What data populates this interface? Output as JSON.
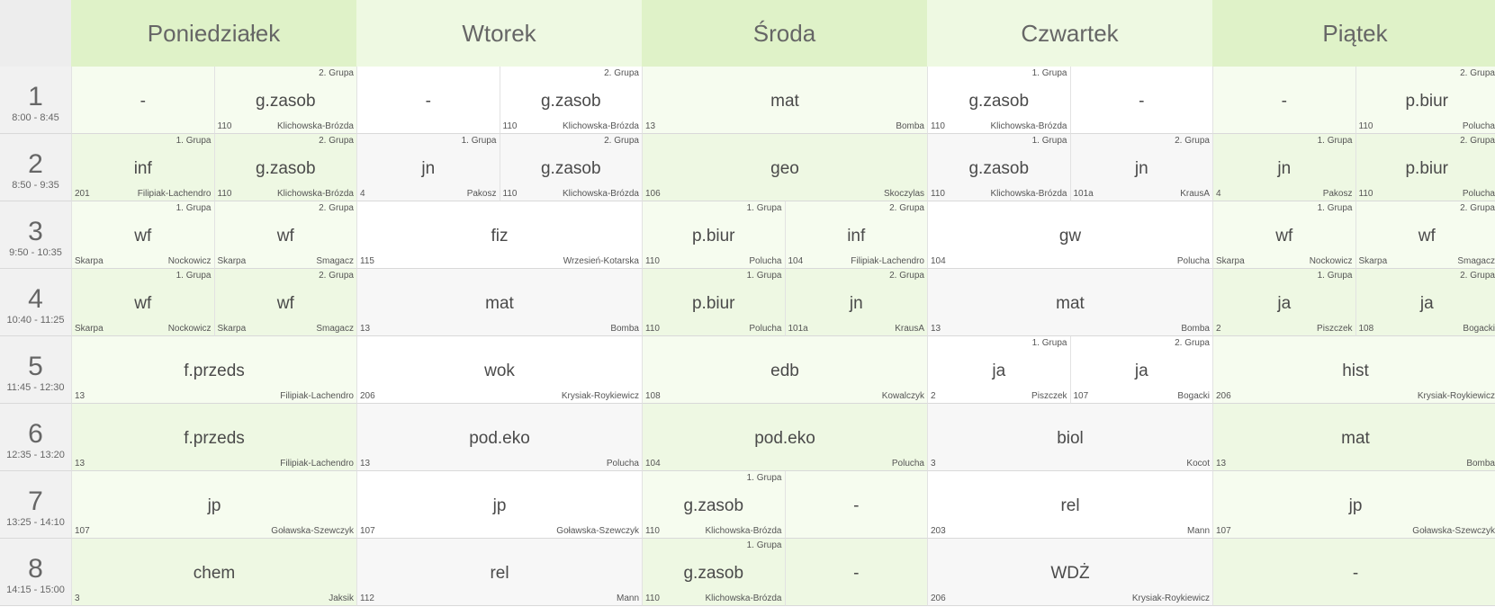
{
  "days": [
    "Poniedziałek",
    "Wtorek",
    "Środa",
    "Czwartek",
    "Piątek"
  ],
  "periods": [
    {
      "num": "1",
      "time": "8:00 - 8:45"
    },
    {
      "num": "2",
      "time": "8:50 - 9:35"
    },
    {
      "num": "3",
      "time": "9:50 - 10:35"
    },
    {
      "num": "4",
      "time": "10:40 - 11:25"
    },
    {
      "num": "5",
      "time": "11:45 - 12:30"
    },
    {
      "num": "6",
      "time": "12:35 - 13:20"
    },
    {
      "num": "7",
      "time": "13:25 - 14:10"
    },
    {
      "num": "8",
      "time": "14:15 - 15:00"
    }
  ],
  "grid": [
    [
      [
        {
          "subj": "-"
        },
        {
          "subj": "g.zasob",
          "grp": "2. Grupa",
          "room": "110",
          "teacher": "Klichowska-Brózda"
        }
      ],
      [
        {
          "subj": "-"
        },
        {
          "subj": "g.zasob",
          "grp": "2. Grupa",
          "room": "110",
          "teacher": "Klichowska-Brózda"
        }
      ],
      [
        {
          "subj": "mat",
          "room": "13",
          "teacher": "Bomba"
        }
      ],
      [
        {
          "subj": "g.zasob",
          "grp": "1. Grupa",
          "room": "110",
          "teacher": "Klichowska-Brózda"
        },
        {
          "subj": "-"
        }
      ],
      [
        {
          "subj": "-"
        },
        {
          "subj": "p.biur",
          "grp": "2. Grupa",
          "room": "110",
          "teacher": "Polucha"
        }
      ]
    ],
    [
      [
        {
          "subj": "inf",
          "grp": "1. Grupa",
          "room": "201",
          "teacher": "Filipiak-Lachendro"
        },
        {
          "subj": "g.zasob",
          "grp": "2. Grupa",
          "room": "110",
          "teacher": "Klichowska-Brózda"
        }
      ],
      [
        {
          "subj": "jn",
          "grp": "1. Grupa",
          "room": "4",
          "teacher": "Pakosz"
        },
        {
          "subj": "g.zasob",
          "grp": "2. Grupa",
          "room": "110",
          "teacher": "Klichowska-Brózda"
        }
      ],
      [
        {
          "subj": "geo",
          "room": "106",
          "teacher": "Skoczylas"
        }
      ],
      [
        {
          "subj": "g.zasob",
          "grp": "1. Grupa",
          "room": "110",
          "teacher": "Klichowska-Brózda"
        },
        {
          "subj": "jn",
          "grp": "2. Grupa",
          "room": "101a",
          "teacher": "KrausA"
        }
      ],
      [
        {
          "subj": "jn",
          "grp": "1. Grupa",
          "room": "4",
          "teacher": "Pakosz"
        },
        {
          "subj": "p.biur",
          "grp": "2. Grupa",
          "room": "110",
          "teacher": "Polucha"
        }
      ]
    ],
    [
      [
        {
          "subj": "wf",
          "grp": "1. Grupa",
          "room": "Skarpa",
          "teacher": "Nockowicz"
        },
        {
          "subj": "wf",
          "grp": "2. Grupa",
          "room": "Skarpa",
          "teacher": "Smagacz"
        }
      ],
      [
        {
          "subj": "fiz",
          "room": "115",
          "teacher": "Wrzesień-Kotarska"
        }
      ],
      [
        {
          "subj": "p.biur",
          "grp": "1. Grupa",
          "room": "110",
          "teacher": "Polucha"
        },
        {
          "subj": "inf",
          "grp": "2. Grupa",
          "room": "104",
          "teacher": "Filipiak-Lachendro"
        }
      ],
      [
        {
          "subj": "gw",
          "room": "104",
          "teacher": "Polucha"
        }
      ],
      [
        {
          "subj": "wf",
          "grp": "1. Grupa",
          "room": "Skarpa",
          "teacher": "Nockowicz"
        },
        {
          "subj": "wf",
          "grp": "2. Grupa",
          "room": "Skarpa",
          "teacher": "Smagacz"
        }
      ]
    ],
    [
      [
        {
          "subj": "wf",
          "grp": "1. Grupa",
          "room": "Skarpa",
          "teacher": "Nockowicz"
        },
        {
          "subj": "wf",
          "grp": "2. Grupa",
          "room": "Skarpa",
          "teacher": "Smagacz"
        }
      ],
      [
        {
          "subj": "mat",
          "room": "13",
          "teacher": "Bomba"
        }
      ],
      [
        {
          "subj": "p.biur",
          "grp": "1. Grupa",
          "room": "110",
          "teacher": "Polucha"
        },
        {
          "subj": "jn",
          "grp": "2. Grupa",
          "room": "101a",
          "teacher": "KrausA"
        }
      ],
      [
        {
          "subj": "mat",
          "room": "13",
          "teacher": "Bomba"
        }
      ],
      [
        {
          "subj": "ja",
          "grp": "1. Grupa",
          "room": "2",
          "teacher": "Piszczek"
        },
        {
          "subj": "ja",
          "grp": "2. Grupa",
          "room": "108",
          "teacher": "Bogacki"
        }
      ]
    ],
    [
      [
        {
          "subj": "f.przeds",
          "room": "13",
          "teacher": "Filipiak-Lachendro"
        }
      ],
      [
        {
          "subj": "wok",
          "room": "206",
          "teacher": "Krysiak-Roykiewicz"
        }
      ],
      [
        {
          "subj": "edb",
          "room": "108",
          "teacher": "Kowalczyk"
        }
      ],
      [
        {
          "subj": "ja",
          "grp": "1. Grupa",
          "room": "2",
          "teacher": "Piszczek"
        },
        {
          "subj": "ja",
          "grp": "2. Grupa",
          "room": "107",
          "teacher": "Bogacki"
        }
      ],
      [
        {
          "subj": "hist",
          "room": "206",
          "teacher": "Krysiak-Roykiewicz"
        }
      ]
    ],
    [
      [
        {
          "subj": "f.przeds",
          "room": "13",
          "teacher": "Filipiak-Lachendro"
        }
      ],
      [
        {
          "subj": "pod.eko",
          "room": "13",
          "teacher": "Polucha"
        }
      ],
      [
        {
          "subj": "pod.eko",
          "room": "104",
          "teacher": "Polucha"
        }
      ],
      [
        {
          "subj": "biol",
          "room": "3",
          "teacher": "Kocot"
        }
      ],
      [
        {
          "subj": "mat",
          "room": "13",
          "teacher": "Bomba"
        }
      ]
    ],
    [
      [
        {
          "subj": "jp",
          "room": "107",
          "teacher": "Goławska-Szewczyk"
        }
      ],
      [
        {
          "subj": "jp",
          "room": "107",
          "teacher": "Goławska-Szewczyk"
        }
      ],
      [
        {
          "subj": "g.zasob",
          "grp": "1. Grupa",
          "room": "110",
          "teacher": "Klichowska-Brózda"
        },
        {
          "subj": "-"
        }
      ],
      [
        {
          "subj": "rel",
          "room": "203",
          "teacher": "Mann"
        }
      ],
      [
        {
          "subj": "jp",
          "room": "107",
          "teacher": "Goławska-Szewczyk"
        }
      ]
    ],
    [
      [
        {
          "subj": "chem",
          "room": "3",
          "teacher": "Jaksik"
        }
      ],
      [
        {
          "subj": "rel",
          "room": "112",
          "teacher": "Mann"
        }
      ],
      [
        {
          "subj": "g.zasob",
          "grp": "1. Grupa",
          "room": "110",
          "teacher": "Klichowska-Brózda"
        },
        {
          "subj": "-"
        }
      ],
      [
        {
          "subj": "WDŻ",
          "room": "206",
          "teacher": "Krysiak-Roykiewicz"
        }
      ],
      [
        {
          "subj": "-"
        }
      ]
    ]
  ],
  "colors": {
    "header_dark": "#dff2c8",
    "header_light": "#eef9e2",
    "green_cell": "#eef8e3",
    "green_cell_light": "#f6fcef",
    "grey_cell": "#f7f7f7",
    "white_cell": "#ffffff",
    "label_bg": "#f1f1f1"
  },
  "cell_tones": [
    [
      "g",
      "w",
      "g",
      "w",
      "g"
    ],
    [
      "g",
      "r",
      "g",
      "r",
      "g"
    ],
    [
      "g",
      "w",
      "g",
      "w",
      "g"
    ],
    [
      "g",
      "r",
      "g",
      "r",
      "g"
    ],
    [
      "g",
      "w",
      "g",
      "w",
      "g"
    ],
    [
      "g",
      "r",
      "g",
      "r",
      "g"
    ],
    [
      "g",
      "w",
      "g",
      "w",
      "g"
    ],
    [
      "g",
      "r",
      "g",
      "r",
      "g"
    ]
  ]
}
